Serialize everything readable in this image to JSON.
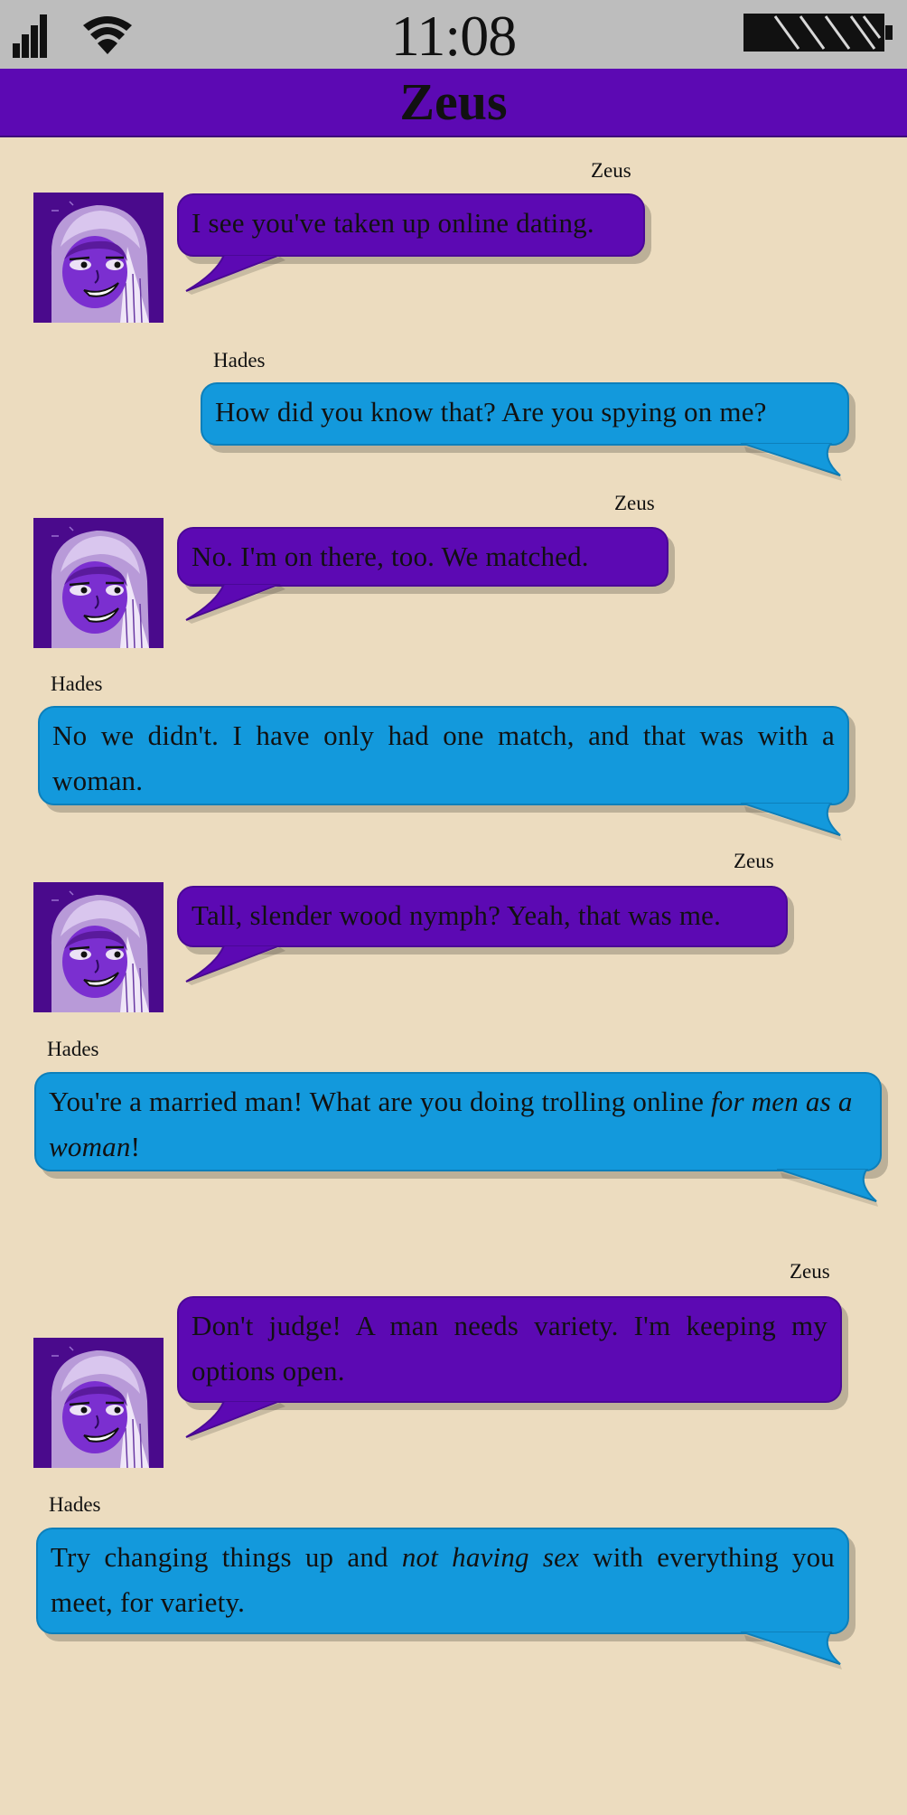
{
  "status_bar": {
    "time": "11:08",
    "icons": [
      "signal-icon",
      "wifi-icon",
      "battery-icon"
    ]
  },
  "header": {
    "title": "Zeus"
  },
  "colors": {
    "zeus_bubble": "#5c09b3",
    "hades_bubble": "#1399dc",
    "background": "#ecdcbf",
    "header": "#5c09b3",
    "status_bar": "#bdbdbd"
  },
  "messages": [
    {
      "sender": "Zeus",
      "text": "I see you've taken up online dating."
    },
    {
      "sender": "Hades",
      "text": "How did you know that? Are you spying on me?"
    },
    {
      "sender": "Zeus",
      "text": "No. I'm on there, too. We matched."
    },
    {
      "sender": "Hades",
      "text": "No we didn't. I have only had one match, and that was with a woman."
    },
    {
      "sender": "Zeus",
      "text": "Tall, slender wood nymph? Yeah, that was me."
    },
    {
      "sender": "Hades",
      "text_before": "You're a married man! What are you doing trolling online ",
      "text_em": "for men as a woman",
      "text_after": "!"
    },
    {
      "sender": "Zeus",
      "text": "Don't judge! A man needs variety. I'm keeping my options open."
    },
    {
      "sender": "Hades",
      "text_before": "Try changing things up and ",
      "text_em": "not having sex",
      "text_after": " with everything you meet, for variety."
    }
  ]
}
